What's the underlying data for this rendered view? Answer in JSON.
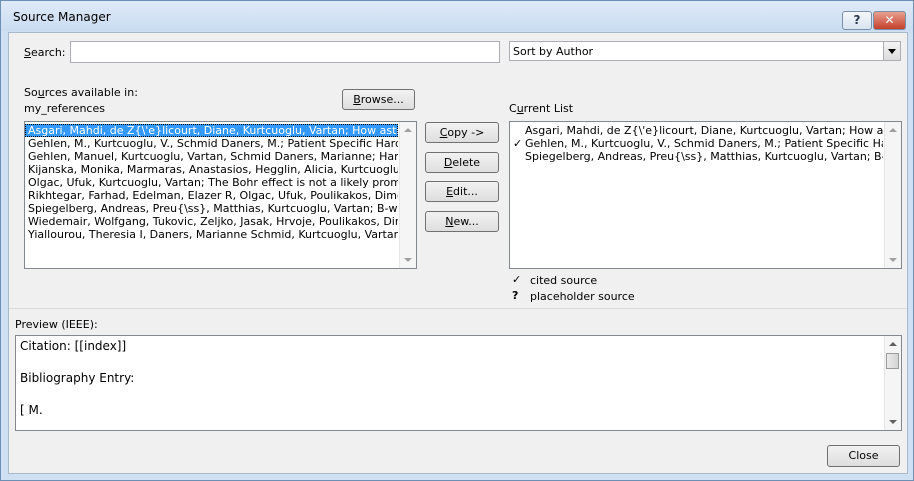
{
  "window": {
    "title": "Source Manager",
    "help_label": "?",
    "close_label": "✕"
  },
  "search": {
    "label_prefix": "",
    "label_mnemonic": "S",
    "label_rest": "earch:",
    "value": ""
  },
  "sort": {
    "selected": "Sort by Author"
  },
  "available": {
    "label_prefix": "So",
    "label_mnemonic": "u",
    "label_rest": "rces available in:",
    "location": "my_references",
    "browse_label_pre": "",
    "browse_mnemonic": "B",
    "browse_label_rest": "rowse...",
    "items": [
      {
        "text": "Asgari, Mahdi, de Z{\\'e}licourt, Diane, Kurtcuoglu, Vartan; How astrocytic",
        "selected": true
      },
      {
        "text": "Gehlen, M., Kurtcuoglu, V., Schmid Daners, M.; Patient Specific Hardwa",
        "selected": false
      },
      {
        "text": "Gehlen, Manuel, Kurtcuoglu, Vartan, Schmid Daners, Marianne; Hardwa",
        "selected": false
      },
      {
        "text": "Kijanska, Monika, Marmaras, Anastasios, Hegglin, Alicia, Kurtcuoglu, Va",
        "selected": false
      },
      {
        "text": "Olgac, Ufuk, Kurtcuoglu, Vartan; The Bohr effect is not a likely promoter",
        "selected": false
      },
      {
        "text": "Rikhtegar, Farhad, Edelman, Elazer R, Olgac, Ufuk, Poulikakos, Dimos, K",
        "selected": false
      },
      {
        "text": "Spiegelberg, Andreas, Preu{\\ss}, Matthias, Kurtcuoglu, Vartan; B-waves r",
        "selected": false
      },
      {
        "text": "Wiedemair, Wolfgang, Tukovic, Zeljko, Jasak, Hrvoje, Poulikakos, Dimos,",
        "selected": false
      },
      {
        "text": "Yiallourou, Theresia I, Daners, Marianne Schmid, Kurtcuoglu, Vartan, Ha",
        "selected": false
      }
    ]
  },
  "actions": {
    "copy": {
      "pre": "",
      "mn": "C",
      "rest": "opy ->"
    },
    "delete": {
      "pre": "",
      "mn": "D",
      "rest": "elete"
    },
    "edit": {
      "pre": "",
      "mn": "E",
      "rest": "dit..."
    },
    "new": {
      "pre": "",
      "mn": "N",
      "rest": "ew..."
    }
  },
  "current": {
    "label_pre": "C",
    "label_mn": "u",
    "label_rest": "rrent List",
    "items": [
      {
        "check": "",
        "text": "Asgari, Mahdi, de Z{\\'e}licourt, Diane, Kurtcuoglu, Vartan; How astrocy"
      },
      {
        "check": "✓",
        "text": "Gehlen, M., Kurtcuoglu, V., Schmid Daners, M.; Patient Specific Hardw"
      },
      {
        "check": "",
        "text": "Spiegelberg, Andreas, Preu{\\ss}, Matthias, Kurtcuoglu, Vartan; B-waves"
      }
    ]
  },
  "legend": {
    "cited_symbol": "✓",
    "cited_label": "cited source",
    "placeholder_symbol": "?",
    "placeholder_label": "placeholder source"
  },
  "preview": {
    "label": "Preview (IEEE):",
    "lines": [
      "Citation:  [[index]]",
      "",
      "Bibliography Entry:",
      "",
      "[ M."
    ]
  },
  "footer": {
    "close_label": "Close"
  }
}
